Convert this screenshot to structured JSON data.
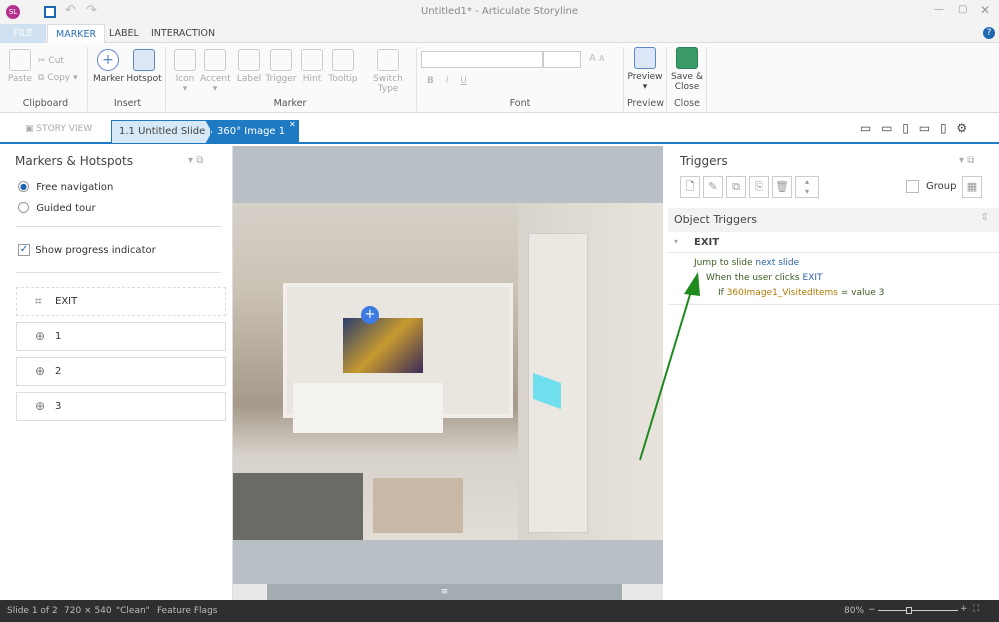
{
  "app": {
    "title": "Untitled1* - Articulate Storyline",
    "logo": "SL"
  },
  "ribbon_tabs": [
    "FILE",
    "MARKER",
    "LABEL",
    "INTERACTION"
  ],
  "ribbon": {
    "clipboard": {
      "paste": "Paste",
      "cut": "Cut",
      "copy": "Copy",
      "group": "Clipboard"
    },
    "insert": {
      "marker": "Marker",
      "hotspot": "Hotspot",
      "group": "Insert"
    },
    "marker": {
      "icon": "Icon",
      "accent": "Accent",
      "label": "Label",
      "trigger": "Trigger",
      "hint": "Hint",
      "tooltip": "Tooltip",
      "switch_type": "Switch Type",
      "group": "Marker"
    },
    "font": {
      "group": "Font",
      "bold": "B",
      "italic": "I",
      "underline": "U",
      "grow": "A",
      "shrink": "A"
    },
    "preview": {
      "label": "Preview",
      "group": "Preview"
    },
    "close": {
      "label": "Save & Close",
      "group": "Close"
    }
  },
  "tabs": {
    "story_view": "STORY VIEW",
    "slide": "1.1 Untitled Slide",
    "image": "360° Image 1"
  },
  "left_panel": {
    "title": "Markers & Hotspots",
    "free_nav": "Free navigation",
    "guided": "Guided tour",
    "progress": "Show progress indicator",
    "items": [
      "EXIT",
      "1",
      "2",
      "3"
    ]
  },
  "triggers": {
    "title": "Triggers",
    "group": "Group",
    "section": "Object Triggers",
    "object": "EXIT",
    "action": "Jump to slide",
    "action_target": "next slide",
    "when": "When the user clicks",
    "when_target": "EXIT",
    "if": "If",
    "variable": "360Image1_VisitedItems",
    "condition": "= value 3"
  },
  "status": {
    "slide": "Slide 1 of 2",
    "size": "720 × 540",
    "theme": "\"Clean\"",
    "flags": "Feature Flags",
    "zoom": "80%"
  },
  "colors": {
    "accent": "#1f7ac4",
    "arrow": "#1e8a1e"
  }
}
